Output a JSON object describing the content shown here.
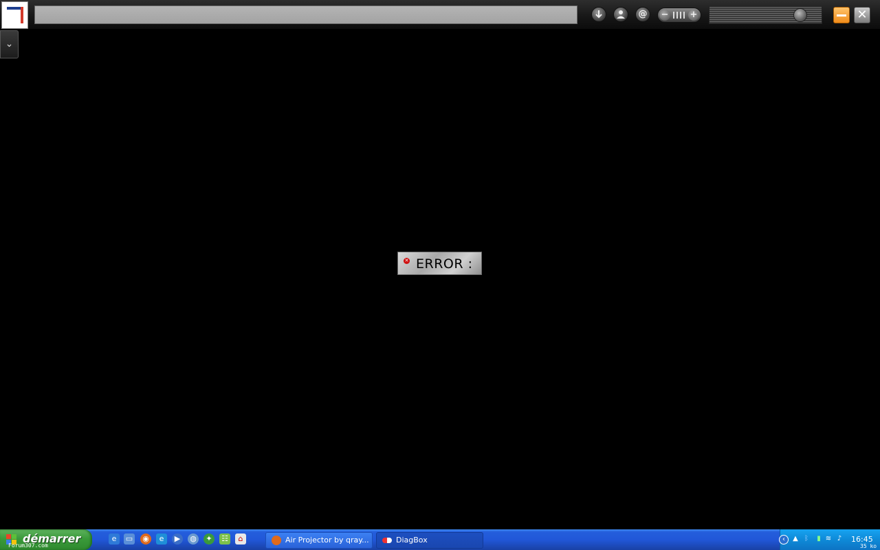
{
  "app": {
    "address_value": "",
    "buttons": {
      "download_icon": "download-icon",
      "user_icon": "user-icon",
      "email_label": "@",
      "zoom_out": "−",
      "zoom_in": "+",
      "close": "✕",
      "side_toggle": "⌄"
    },
    "volume_level": 0.85
  },
  "error": {
    "icon": "✕",
    "text": "ERROR :"
  },
  "taskbar": {
    "start_label": "démarrer",
    "watermark": "Forum307.com",
    "tasks": [
      {
        "label": "Air Projector by qray...",
        "icon": "firefox-icon"
      },
      {
        "label": "DiagBox",
        "icon": "diagbox-icon"
      }
    ],
    "clock": "16:45",
    "size_label": "35 ko"
  },
  "colors": {
    "accent_orange": "#f08c1a",
    "taskbar_blue": "#245edc",
    "start_green": "#3a9a3a",
    "error_red": "#d01010"
  }
}
